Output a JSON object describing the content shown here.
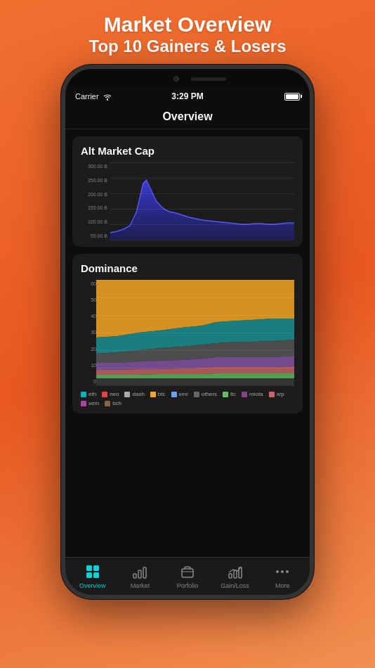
{
  "header": {
    "line1": "Market Overview",
    "line2": "Top 10 Gainers & Losers"
  },
  "status": {
    "carrier": "Carrier",
    "time": "3:29 PM"
  },
  "nav": {
    "title": "Overview"
  },
  "altMarketCap": {
    "title": "Alt Market Cap",
    "yLabels": [
      "300.00 B",
      "250.00 B",
      "200.00 B",
      "150.00 B",
      "100.00 B",
      "50.00 B"
    ]
  },
  "dominance": {
    "title": "Dominance",
    "yLabels": [
      "60",
      "50",
      "40",
      "30",
      "20",
      "10",
      "0"
    ],
    "legend": [
      {
        "label": "eth",
        "color": "#00b4b4"
      },
      {
        "label": "neo",
        "color": "#e84040"
      },
      {
        "label": "dash",
        "color": "#aaa"
      },
      {
        "label": "btc",
        "color": "#f5a623"
      },
      {
        "label": "xmr",
        "color": "#6b9ef5"
      },
      {
        "label": "others",
        "color": "#666"
      },
      {
        "label": "ltc",
        "color": "#60c060"
      },
      {
        "label": "miota",
        "color": "#884488"
      },
      {
        "label": "xrp",
        "color": "#cc6666"
      },
      {
        "label": "xem",
        "color": "#aa44aa"
      },
      {
        "label": "bch",
        "color": "#886644"
      }
    ]
  },
  "tabs": [
    {
      "label": "Overview",
      "active": true
    },
    {
      "label": "Market",
      "active": false
    },
    {
      "label": "Porfolio",
      "active": false
    },
    {
      "label": "Gain/Loss",
      "active": false
    },
    {
      "label": "More",
      "active": false
    }
  ]
}
